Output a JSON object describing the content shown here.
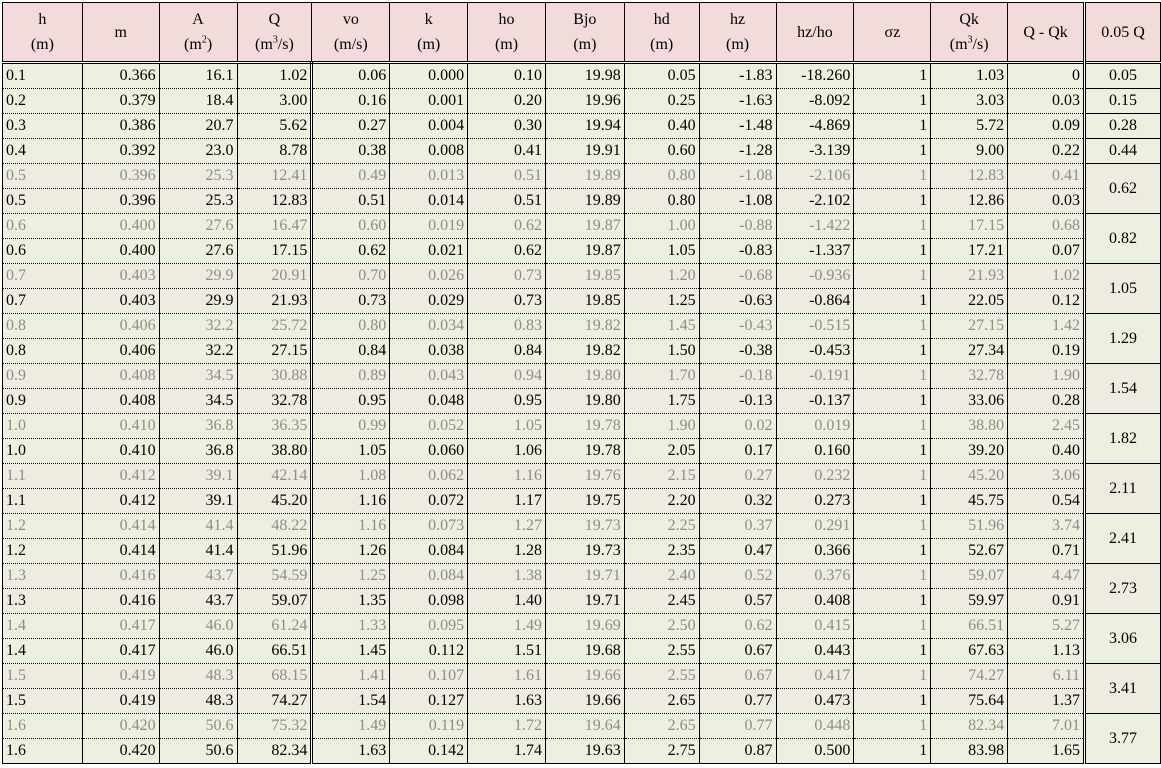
{
  "headers": [
    {
      "top": "h",
      "bottom": "(m)"
    },
    {
      "top": "m",
      "bottom": ""
    },
    {
      "top": "A",
      "bottom": "(m",
      "sup": "2",
      "close": ")"
    },
    {
      "top": "Q",
      "bottom": "(m",
      "sup": "3",
      "close": "/s)"
    },
    {
      "top": "vo",
      "bottom": "(m/s)"
    },
    {
      "top": "k",
      "bottom": "(m)"
    },
    {
      "top": "ho",
      "bottom": "(m)"
    },
    {
      "top": "Bjo",
      "bottom": "(m)"
    },
    {
      "top": "hd",
      "bottom": "(m)"
    },
    {
      "top": "hz",
      "bottom": "(m)"
    },
    {
      "top": "hz/ho",
      "bottom": ""
    },
    {
      "top": "σz",
      "bottom": ""
    },
    {
      "top": "Qk",
      "bottom": "(m",
      "sup": "3",
      "close": "/s)"
    },
    {
      "top": "Q - Qk",
      "bottom": ""
    },
    {
      "top": "0.05 Q",
      "bottom": ""
    }
  ],
  "single_rows": [
    {
      "cells": [
        "0.1",
        "0.366",
        "16.1",
        "1.02",
        "0.06",
        "0.000",
        "0.10",
        "19.98",
        "0.05",
        "-1.83",
        "-18.260",
        "1",
        "1.03",
        "0"
      ],
      "q05": "0.05"
    },
    {
      "cells": [
        "0.2",
        "0.379",
        "18.4",
        "3.00",
        "0.16",
        "0.001",
        "0.20",
        "19.96",
        "0.25",
        "-1.63",
        "-8.092",
        "1",
        "3.03",
        "0.03"
      ],
      "q05": "0.15"
    },
    {
      "cells": [
        "0.3",
        "0.386",
        "20.7",
        "5.62",
        "0.27",
        "0.004",
        "0.30",
        "19.94",
        "0.40",
        "-1.48",
        "-4.869",
        "1",
        "5.72",
        "0.09"
      ],
      "q05": "0.28"
    },
    {
      "cells": [
        "0.4",
        "0.392",
        "23.0",
        "8.78",
        "0.38",
        "0.008",
        "0.41",
        "19.91",
        "0.60",
        "-1.28",
        "-3.139",
        "1",
        "9.00",
        "0.22"
      ],
      "q05": "0.44"
    }
  ],
  "pair_rows": [
    {
      "dim": [
        "0.5",
        "0.396",
        "25.3",
        "12.41",
        "0.49",
        "0.013",
        "0.51",
        "19.89",
        "0.80",
        "-1.08",
        "-2.106",
        "1",
        "12.83",
        "0.41"
      ],
      "main": [
        "0.5",
        "0.396",
        "25.3",
        "12.83",
        "0.51",
        "0.014",
        "0.51",
        "19.89",
        "0.80",
        "-1.08",
        "-2.102",
        "1",
        "12.86",
        "0.03"
      ],
      "q05": "0.62",
      "bg": "beige"
    },
    {
      "dim": [
        "0.6",
        "0.400",
        "27.6",
        "16.47",
        "0.60",
        "0.019",
        "0.62",
        "19.87",
        "1.00",
        "-0.88",
        "-1.422",
        "1",
        "17.15",
        "0.68"
      ],
      "main": [
        "0.6",
        "0.400",
        "27.6",
        "17.15",
        "0.62",
        "0.021",
        "0.62",
        "19.87",
        "1.05",
        "-0.83",
        "-1.337",
        "1",
        "17.21",
        "0.07"
      ],
      "q05": "0.82",
      "bg": "green"
    },
    {
      "dim": [
        "0.7",
        "0.403",
        "29.9",
        "20.91",
        "0.70",
        "0.026",
        "0.73",
        "19.85",
        "1.20",
        "-0.68",
        "-0.936",
        "1",
        "21.93",
        "1.02"
      ],
      "main": [
        "0.7",
        "0.403",
        "29.9",
        "21.93",
        "0.73",
        "0.029",
        "0.73",
        "19.85",
        "1.25",
        "-0.63",
        "-0.864",
        "1",
        "22.05",
        "0.12"
      ],
      "q05": "1.05",
      "bg": "beige"
    },
    {
      "dim": [
        "0.8",
        "0.406",
        "32.2",
        "25.72",
        "0.80",
        "0.034",
        "0.83",
        "19.82",
        "1.45",
        "-0.43",
        "-0.515",
        "1",
        "27.15",
        "1.42"
      ],
      "main": [
        "0.8",
        "0.406",
        "32.2",
        "27.15",
        "0.84",
        "0.038",
        "0.84",
        "19.82",
        "1.50",
        "-0.38",
        "-0.453",
        "1",
        "27.34",
        "0.19"
      ],
      "q05": "1.29",
      "bg": "green"
    },
    {
      "dim": [
        "0.9",
        "0.408",
        "34.5",
        "30.88",
        "0.89",
        "0.043",
        "0.94",
        "19.80",
        "1.70",
        "-0.18",
        "-0.191",
        "1",
        "32.78",
        "1.90"
      ],
      "main": [
        "0.9",
        "0.408",
        "34.5",
        "32.78",
        "0.95",
        "0.048",
        "0.95",
        "19.80",
        "1.75",
        "-0.13",
        "-0.137",
        "1",
        "33.06",
        "0.28"
      ],
      "q05": "1.54",
      "bg": "beige"
    },
    {
      "dim": [
        "1.0",
        "0.410",
        "36.8",
        "36.35",
        "0.99",
        "0.052",
        "1.05",
        "19.78",
        "1.90",
        "0.02",
        "0.019",
        "1",
        "38.80",
        "2.45"
      ],
      "main": [
        "1.0",
        "0.410",
        "36.8",
        "38.80",
        "1.05",
        "0.060",
        "1.06",
        "19.78",
        "2.05",
        "0.17",
        "0.160",
        "1",
        "39.20",
        "0.40"
      ],
      "q05": "1.82",
      "bg": "green"
    },
    {
      "dim": [
        "1.1",
        "0.412",
        "39.1",
        "42.14",
        "1.08",
        "0.062",
        "1.16",
        "19.76",
        "2.15",
        "0.27",
        "0.232",
        "1",
        "45.20",
        "3.06"
      ],
      "main": [
        "1.1",
        "0.412",
        "39.1",
        "45.20",
        "1.16",
        "0.072",
        "1.17",
        "19.75",
        "2.20",
        "0.32",
        "0.273",
        "1",
        "45.75",
        "0.54"
      ],
      "q05": "2.11",
      "bg": "beige"
    },
    {
      "dim": [
        "1.2",
        "0.414",
        "41.4",
        "48.22",
        "1.16",
        "0.073",
        "1.27",
        "19.73",
        "2.25",
        "0.37",
        "0.291",
        "1",
        "51.96",
        "3.74"
      ],
      "main": [
        "1.2",
        "0.414",
        "41.4",
        "51.96",
        "1.26",
        "0.084",
        "1.28",
        "19.73",
        "2.35",
        "0.47",
        "0.366",
        "1",
        "52.67",
        "0.71"
      ],
      "q05": "2.41",
      "bg": "green"
    },
    {
      "dim": [
        "1.3",
        "0.416",
        "43.7",
        "54.59",
        "1.25",
        "0.084",
        "1.38",
        "19.71",
        "2.40",
        "0.52",
        "0.376",
        "1",
        "59.07",
        "4.47"
      ],
      "main": [
        "1.3",
        "0.416",
        "43.7",
        "59.07",
        "1.35",
        "0.098",
        "1.40",
        "19.71",
        "2.45",
        "0.57",
        "0.408",
        "1",
        "59.97",
        "0.91"
      ],
      "q05": "2.73",
      "bg": "beige"
    },
    {
      "dim": [
        "1.4",
        "0.417",
        "46.0",
        "61.24",
        "1.33",
        "0.095",
        "1.49",
        "19.69",
        "2.50",
        "0.62",
        "0.415",
        "1",
        "66.51",
        "5.27"
      ],
      "main": [
        "1.4",
        "0.417",
        "46.0",
        "66.51",
        "1.45",
        "0.112",
        "1.51",
        "19.68",
        "2.55",
        "0.67",
        "0.443",
        "1",
        "67.63",
        "1.13"
      ],
      "q05": "3.06",
      "bg": "green"
    },
    {
      "dim": [
        "1.5",
        "0.419",
        "48.3",
        "68.15",
        "1.41",
        "0.107",
        "1.61",
        "19.66",
        "2.55",
        "0.67",
        "0.417",
        "1",
        "74.27",
        "6.11"
      ],
      "main": [
        "1.5",
        "0.419",
        "48.3",
        "74.27",
        "1.54",
        "0.127",
        "1.63",
        "19.66",
        "2.65",
        "0.77",
        "0.473",
        "1",
        "75.64",
        "1.37"
      ],
      "q05": "3.41",
      "bg": "beige"
    },
    {
      "dim": [
        "1.6",
        "0.420",
        "50.6",
        "75.32",
        "1.49",
        "0.119",
        "1.72",
        "19.64",
        "2.65",
        "0.77",
        "0.448",
        "1",
        "82.34",
        "7.01"
      ],
      "main": [
        "1.6",
        "0.420",
        "50.6",
        "82.34",
        "1.63",
        "0.142",
        "1.74",
        "19.63",
        "2.75",
        "0.87",
        "0.500",
        "1",
        "83.98",
        "1.65"
      ],
      "q05": "3.77",
      "bg": "green"
    }
  ]
}
